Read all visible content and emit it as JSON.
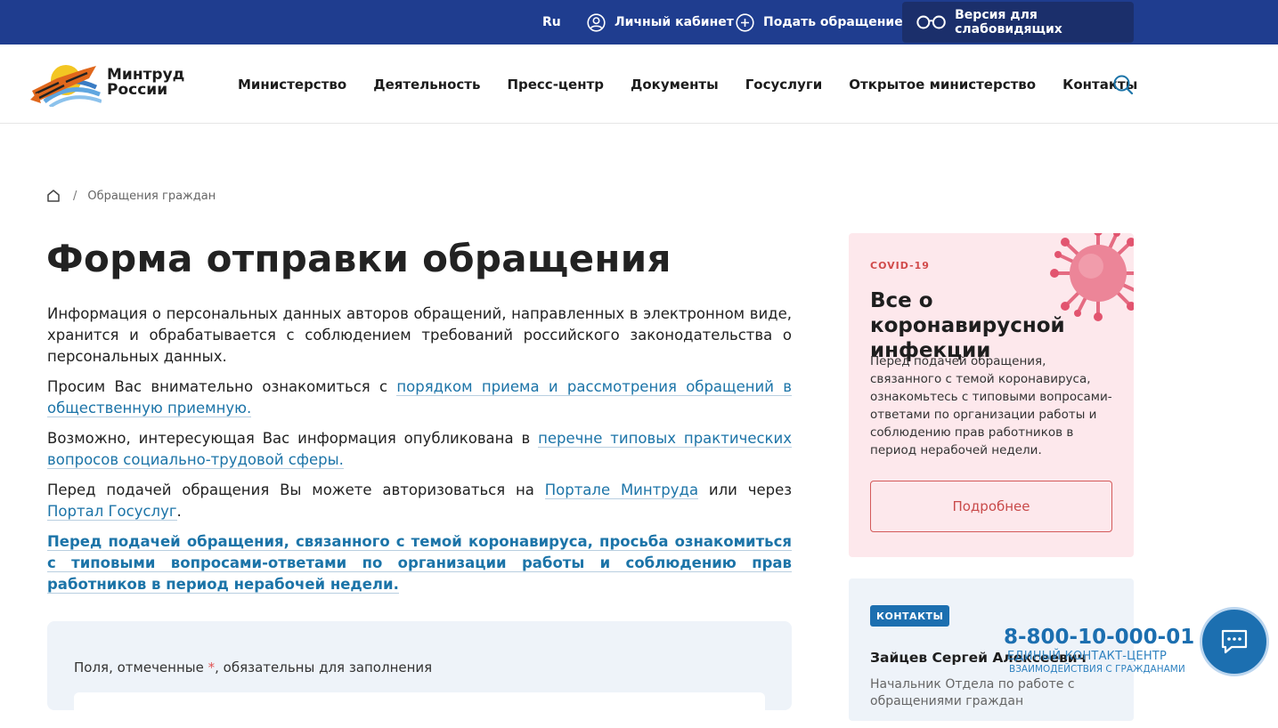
{
  "topbar": {
    "lang": "Ru",
    "cabinet": "Личный кабинет",
    "appeal": "Подать обращение",
    "vision": "Версия для слабовидящих"
  },
  "header": {
    "logo_line1": "Минтруд",
    "logo_line2": "России",
    "nav": [
      "Министерство",
      "Деятельность",
      "Пресс-центр",
      "Документы",
      "Госуслуги",
      "Открытое министерство",
      "Контакты"
    ]
  },
  "breadcrumb": {
    "sep": "/",
    "current": "Обращения граждан"
  },
  "main": {
    "title": "Форма отправки обращения",
    "p1": "Информация о персональных данных авторов обращений, направленных в электронном виде, хранится и обрабатывается с соблюдением требований российского законодательства о персональных данных.",
    "p2_text": "Просим Вас внимательно ознакомиться с ",
    "p2_link": "порядком приема и рассмотрения обращений в общественную приемную.",
    "p3_text": "Возможно, интересующая Вас информация опубликована в ",
    "p3_link": "перечне типовых практических вопросов социально-трудовой сферы.",
    "p4_text1": "Перед подачей обращения Вы можете авторизоваться на ",
    "p4_link1": "Портале Минтруда",
    "p4_text2": " или через ",
    "p4_link2": "Портал Госуслуг",
    "p4_text3": ".",
    "p5_link": "Перед подачей обращения, связанного с темой коронавируса, просьба ознакомиться с типовыми вопросами-ответами по организации работы и соблюдению прав работников в период нерабочей недели.",
    "form_note_pre": "Поля, отмеченные ",
    "form_note_star": "*",
    "form_note_post": ", обязательны для заполнения"
  },
  "covid": {
    "tag": "COVID-19",
    "title": "Все о коронавирусной инфекции",
    "text": "Перед подачей обращения, связанного с темой коронавируса, ознакомьтесь с типовыми вопросами-ответами по организации работы и соблюдению прав работников в период нерабочей недели.",
    "button": "Подробнее"
  },
  "contacts": {
    "tag": "КОНТАКТЫ",
    "name": "Зайцев Сергей Алексеевич",
    "role": "Начальник Отдела по работе с обращениями граждан"
  },
  "hotline": {
    "phone": "8-800-10-000-01",
    "label": "ЕДИНЫЙ КОНТАКТ-ЦЕНТР",
    "sub": "ВЗАИМОДЕЙСТВИЯ С ГРАЖДАНАМИ"
  },
  "colors": {
    "topbar": "#1f3d8f",
    "link": "#1c74a8",
    "covid_bg": "#fde8ec",
    "accent_red": "#d14b4b",
    "contacts_blue": "#1c6fb0"
  }
}
